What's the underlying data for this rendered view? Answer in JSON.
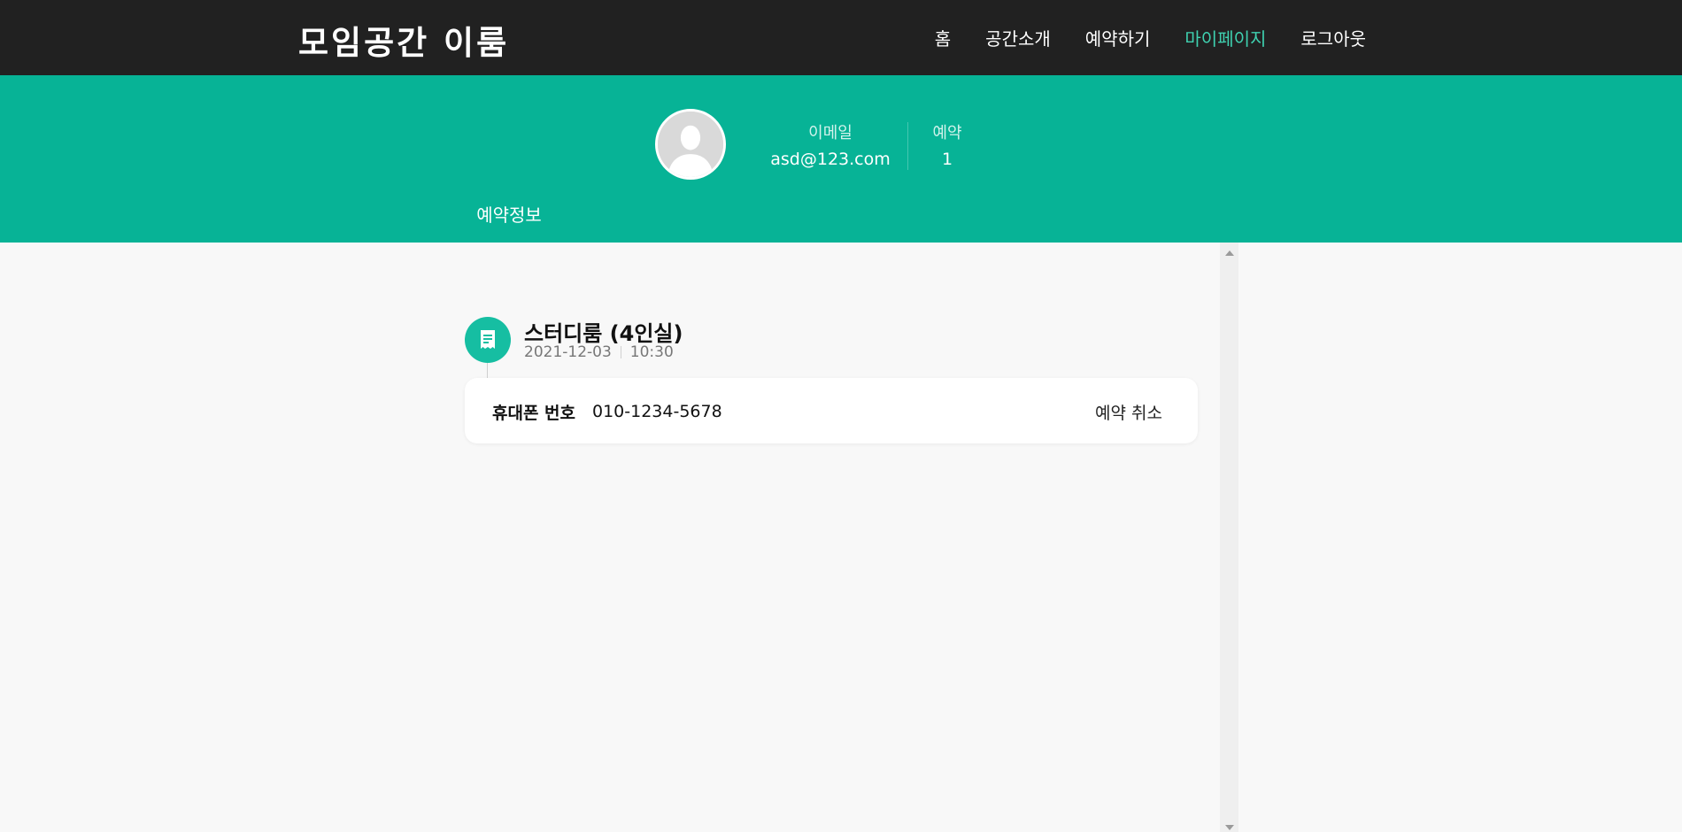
{
  "header": {
    "logo": "모임공간 이룸",
    "nav": [
      {
        "label": "홈",
        "active": false
      },
      {
        "label": "공간소개",
        "active": false
      },
      {
        "label": "예약하기",
        "active": false
      },
      {
        "label": "마이페이지",
        "active": true
      },
      {
        "label": "로그아웃",
        "active": false
      }
    ]
  },
  "profile": {
    "avatar_icon": "user-silhouette-icon",
    "email_label": "이메일",
    "email_value": "asd@123.com",
    "reservation_label": "예약",
    "reservation_value": "1"
  },
  "tabs": {
    "active_tab": "예약정보"
  },
  "reservation": {
    "icon": "receipt-icon",
    "room_name": "스터디룸 (4인실)",
    "date": "2021-12-03",
    "time": "10:30",
    "phone_label": "휴대폰 번호",
    "phone_value": "010-1234-5678",
    "cancel_label": "예약 취소"
  },
  "colors": {
    "topbar": "#212121",
    "accent": "#07b396",
    "active_nav": "#3fd1b0",
    "background": "#f8f8f8"
  }
}
